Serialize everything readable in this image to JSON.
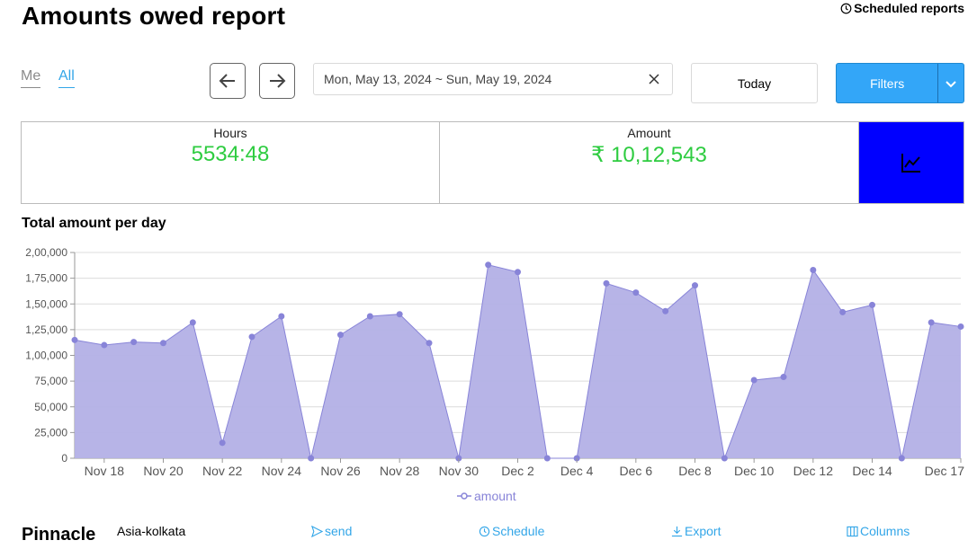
{
  "header": {
    "title": "Amounts owed report",
    "scheduled_reports": "Scheduled reports"
  },
  "tabs": [
    {
      "label": "Me",
      "active": false
    },
    {
      "label": "All",
      "active": true
    }
  ],
  "date_filter": {
    "range": "Mon, May 13, 2024 ~ Sun, May 19, 2024"
  },
  "toolbar": {
    "today_label": "Today",
    "filters_label": "Filters"
  },
  "stats": {
    "hours": {
      "label": "Hours",
      "value": "5534:48"
    },
    "amount": {
      "label": "Amount",
      "value": "₹ 10,12,543"
    }
  },
  "colors": {
    "accent": "#33a6f8",
    "link": "#33a6e8",
    "stat_value": "#2ecc40",
    "chart_fill": "#b3b0e6",
    "chart_stroke": "#8884d8",
    "toggle": "#0000ff"
  },
  "chart_title": "Total amount per day",
  "chart_data": {
    "type": "area",
    "ylim": [
      0,
      200000
    ],
    "yticks": [
      0,
      25000,
      50000,
      75000,
      100000,
      125000,
      150000,
      175000,
      200000
    ],
    "ytick_labels": [
      "0",
      "25,000",
      "50,000",
      "75,000",
      "1,00,000",
      "1,25,000",
      "1,50,000",
      "1,75,000",
      "2,00,000"
    ],
    "grid": true,
    "legend_position": "bottom",
    "x": [
      "Nov 17",
      "Nov 18",
      "Nov 19",
      "Nov 20",
      "Nov 21",
      "Nov 22",
      "Nov 23",
      "Nov 24",
      "Nov 25",
      "Nov 26",
      "Nov 27",
      "Nov 28",
      "Nov 29",
      "Nov 30",
      "Dec 1",
      "Dec 2",
      "Dec 3",
      "Dec 4",
      "Dec 5",
      "Dec 6",
      "Dec 7",
      "Dec 8",
      "Dec 9",
      "Dec 10",
      "Dec 11",
      "Dec 12",
      "Dec 13",
      "Dec 14",
      "Dec 15",
      "Dec 16",
      "Dec 17"
    ],
    "x_tick_labels": [
      "Nov 18",
      "Nov 20",
      "Nov 22",
      "Nov 24",
      "Nov 26",
      "Nov 28",
      "Nov 30",
      "Dec 2",
      "Dec 4",
      "Dec 6",
      "Dec 8",
      "Dec 10",
      "Dec 12",
      "Dec 14",
      "Dec 17"
    ],
    "series": [
      {
        "name": "amount",
        "values": [
          115000,
          110000,
          113000,
          112000,
          132000,
          15000,
          118000,
          138000,
          0,
          120000,
          138000,
          140000,
          112000,
          0,
          188000,
          181000,
          0,
          0,
          170000,
          161000,
          143000,
          168000,
          0,
          76000,
          79000,
          183000,
          142000,
          149000,
          0,
          132000,
          128000
        ]
      }
    ]
  },
  "footer": {
    "title": "Pinnacle",
    "timezone": "Asia-kolkata",
    "actions": {
      "send": "send",
      "schedule": "Schedule",
      "export": "Export",
      "columns": "Columns"
    }
  }
}
